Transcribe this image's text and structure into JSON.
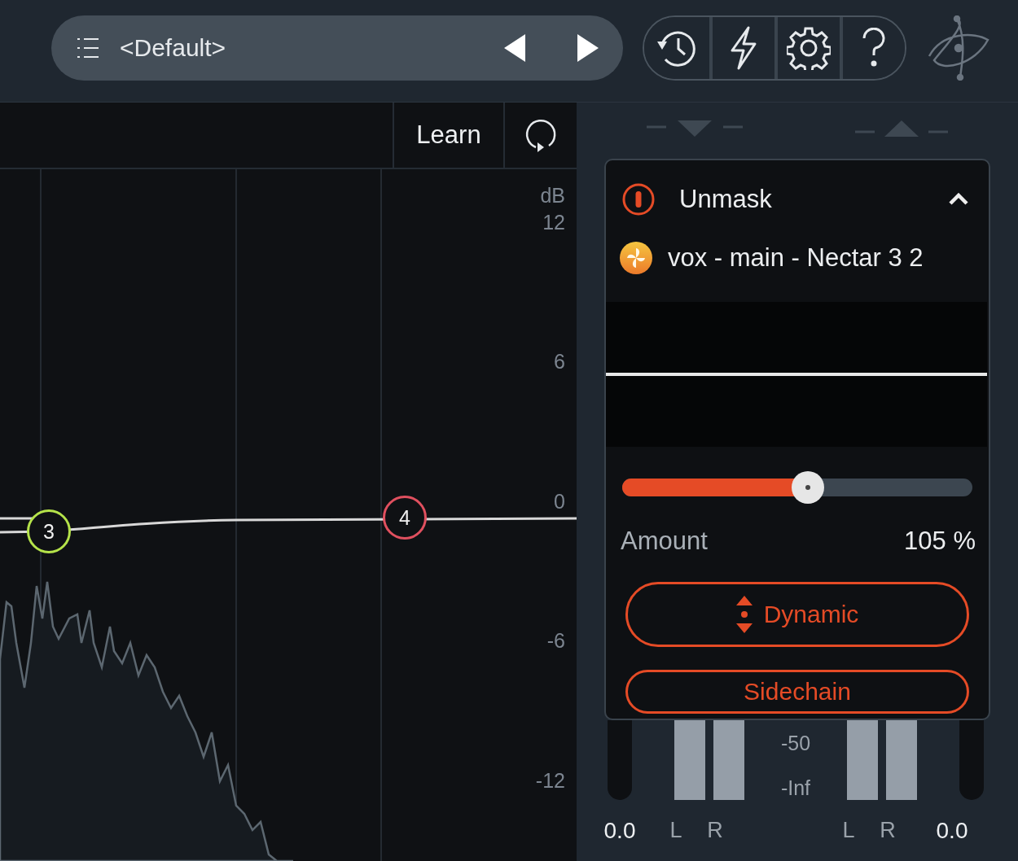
{
  "preset": {
    "name": "<Default>"
  },
  "graph_header": {
    "learn_label": "Learn"
  },
  "db_scale": [
    "dB",
    "12",
    "6",
    "0",
    "-6",
    "-12"
  ],
  "nodes": [
    {
      "label": "3",
      "color": "#b5e34a"
    },
    {
      "label": "4",
      "color": "#e0505f"
    }
  ],
  "module": {
    "title": "Unmask",
    "enabled": true,
    "expanded": true,
    "source": "vox - main - Nectar 3 2",
    "amount": {
      "label": "Amount",
      "value": "105 %",
      "level": 0.53
    },
    "buttons": [
      {
        "kind": "dynamic",
        "label": "Dynamic"
      },
      {
        "kind": "sidechain",
        "label": "Sidechain"
      }
    ]
  },
  "meters": {
    "scale": [
      "-50",
      "-Inf"
    ],
    "input": {
      "peak": "0.0",
      "channels": [
        "L",
        "R"
      ]
    },
    "output": {
      "peak": "0.0",
      "channels": [
        "L",
        "R"
      ]
    }
  }
}
